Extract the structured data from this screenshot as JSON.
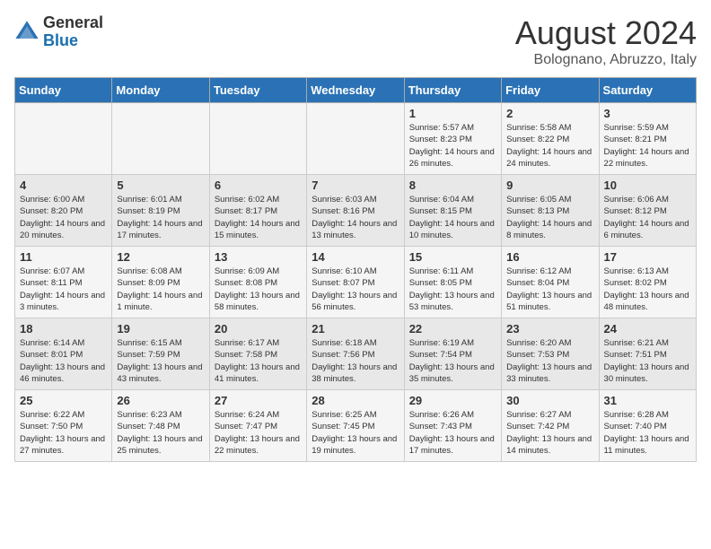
{
  "header": {
    "logo_general": "General",
    "logo_blue": "Blue",
    "month_title": "August 2024",
    "location": "Bolognano, Abruzzo, Italy"
  },
  "days_of_week": [
    "Sunday",
    "Monday",
    "Tuesday",
    "Wednesday",
    "Thursday",
    "Friday",
    "Saturday"
  ],
  "weeks": [
    [
      {
        "day": "",
        "info": ""
      },
      {
        "day": "",
        "info": ""
      },
      {
        "day": "",
        "info": ""
      },
      {
        "day": "",
        "info": ""
      },
      {
        "day": "1",
        "info": "Sunrise: 5:57 AM\nSunset: 8:23 PM\nDaylight: 14 hours and 26 minutes."
      },
      {
        "day": "2",
        "info": "Sunrise: 5:58 AM\nSunset: 8:22 PM\nDaylight: 14 hours and 24 minutes."
      },
      {
        "day": "3",
        "info": "Sunrise: 5:59 AM\nSunset: 8:21 PM\nDaylight: 14 hours and 22 minutes."
      }
    ],
    [
      {
        "day": "4",
        "info": "Sunrise: 6:00 AM\nSunset: 8:20 PM\nDaylight: 14 hours and 20 minutes."
      },
      {
        "day": "5",
        "info": "Sunrise: 6:01 AM\nSunset: 8:19 PM\nDaylight: 14 hours and 17 minutes."
      },
      {
        "day": "6",
        "info": "Sunrise: 6:02 AM\nSunset: 8:17 PM\nDaylight: 14 hours and 15 minutes."
      },
      {
        "day": "7",
        "info": "Sunrise: 6:03 AM\nSunset: 8:16 PM\nDaylight: 14 hours and 13 minutes."
      },
      {
        "day": "8",
        "info": "Sunrise: 6:04 AM\nSunset: 8:15 PM\nDaylight: 14 hours and 10 minutes."
      },
      {
        "day": "9",
        "info": "Sunrise: 6:05 AM\nSunset: 8:13 PM\nDaylight: 14 hours and 8 minutes."
      },
      {
        "day": "10",
        "info": "Sunrise: 6:06 AM\nSunset: 8:12 PM\nDaylight: 14 hours and 6 minutes."
      }
    ],
    [
      {
        "day": "11",
        "info": "Sunrise: 6:07 AM\nSunset: 8:11 PM\nDaylight: 14 hours and 3 minutes."
      },
      {
        "day": "12",
        "info": "Sunrise: 6:08 AM\nSunset: 8:09 PM\nDaylight: 14 hours and 1 minute."
      },
      {
        "day": "13",
        "info": "Sunrise: 6:09 AM\nSunset: 8:08 PM\nDaylight: 13 hours and 58 minutes."
      },
      {
        "day": "14",
        "info": "Sunrise: 6:10 AM\nSunset: 8:07 PM\nDaylight: 13 hours and 56 minutes."
      },
      {
        "day": "15",
        "info": "Sunrise: 6:11 AM\nSunset: 8:05 PM\nDaylight: 13 hours and 53 minutes."
      },
      {
        "day": "16",
        "info": "Sunrise: 6:12 AM\nSunset: 8:04 PM\nDaylight: 13 hours and 51 minutes."
      },
      {
        "day": "17",
        "info": "Sunrise: 6:13 AM\nSunset: 8:02 PM\nDaylight: 13 hours and 48 minutes."
      }
    ],
    [
      {
        "day": "18",
        "info": "Sunrise: 6:14 AM\nSunset: 8:01 PM\nDaylight: 13 hours and 46 minutes."
      },
      {
        "day": "19",
        "info": "Sunrise: 6:15 AM\nSunset: 7:59 PM\nDaylight: 13 hours and 43 minutes."
      },
      {
        "day": "20",
        "info": "Sunrise: 6:17 AM\nSunset: 7:58 PM\nDaylight: 13 hours and 41 minutes."
      },
      {
        "day": "21",
        "info": "Sunrise: 6:18 AM\nSunset: 7:56 PM\nDaylight: 13 hours and 38 minutes."
      },
      {
        "day": "22",
        "info": "Sunrise: 6:19 AM\nSunset: 7:54 PM\nDaylight: 13 hours and 35 minutes."
      },
      {
        "day": "23",
        "info": "Sunrise: 6:20 AM\nSunset: 7:53 PM\nDaylight: 13 hours and 33 minutes."
      },
      {
        "day": "24",
        "info": "Sunrise: 6:21 AM\nSunset: 7:51 PM\nDaylight: 13 hours and 30 minutes."
      }
    ],
    [
      {
        "day": "25",
        "info": "Sunrise: 6:22 AM\nSunset: 7:50 PM\nDaylight: 13 hours and 27 minutes."
      },
      {
        "day": "26",
        "info": "Sunrise: 6:23 AM\nSunset: 7:48 PM\nDaylight: 13 hours and 25 minutes."
      },
      {
        "day": "27",
        "info": "Sunrise: 6:24 AM\nSunset: 7:47 PM\nDaylight: 13 hours and 22 minutes."
      },
      {
        "day": "28",
        "info": "Sunrise: 6:25 AM\nSunset: 7:45 PM\nDaylight: 13 hours and 19 minutes."
      },
      {
        "day": "29",
        "info": "Sunrise: 6:26 AM\nSunset: 7:43 PM\nDaylight: 13 hours and 17 minutes."
      },
      {
        "day": "30",
        "info": "Sunrise: 6:27 AM\nSunset: 7:42 PM\nDaylight: 13 hours and 14 minutes."
      },
      {
        "day": "31",
        "info": "Sunrise: 6:28 AM\nSunset: 7:40 PM\nDaylight: 13 hours and 11 minutes."
      }
    ]
  ]
}
